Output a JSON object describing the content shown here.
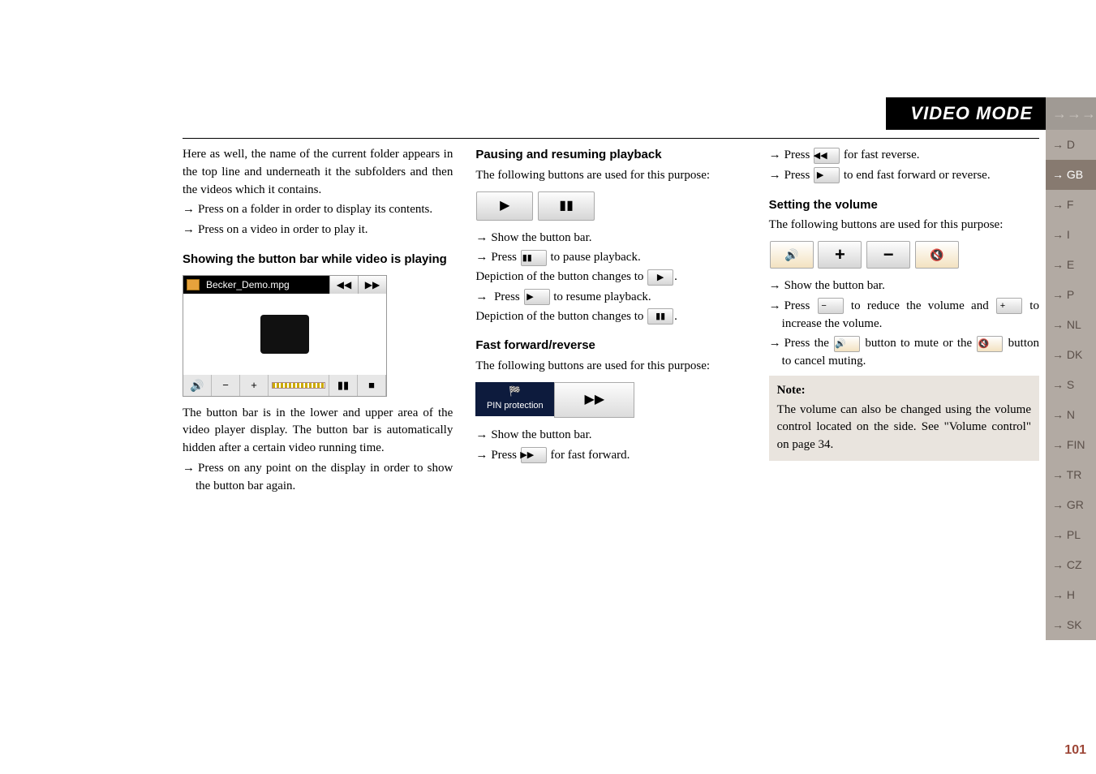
{
  "header": {
    "title": "VIDEO MODE",
    "arrows": "→→→"
  },
  "tabs": [
    {
      "label": "→ D",
      "active": false
    },
    {
      "label": "→ GB",
      "active": true
    },
    {
      "label": "→ F",
      "active": false
    },
    {
      "label": "→ I",
      "active": false
    },
    {
      "label": "→ E",
      "active": false
    },
    {
      "label": "→ P",
      "active": false
    },
    {
      "label": "→ NL",
      "active": false
    },
    {
      "label": "→ DK",
      "active": false
    },
    {
      "label": "→ S",
      "active": false
    },
    {
      "label": "→ N",
      "active": false
    },
    {
      "label": "→ FIN",
      "active": false
    },
    {
      "label": "→ TR",
      "active": false
    },
    {
      "label": "→ GR",
      "active": false
    },
    {
      "label": "→ PL",
      "active": false
    },
    {
      "label": "→ CZ",
      "active": false
    },
    {
      "label": "→ H",
      "active": false
    },
    {
      "label": "→ SK",
      "active": false
    }
  ],
  "col1": {
    "p1": "Here as well, the name of the current folder appears in the top line and underneath it the subfolders and then the videos which it contains.",
    "b1": "Press on a folder in order to display its contents.",
    "b2": "Press on a video in order to play it.",
    "h1": "Showing the button bar while video is playing",
    "player": {
      "title": "Becker_Demo.mpg",
      "rev": "◀◀",
      "fwd": "▶▶",
      "minus": "−",
      "plus": "+",
      "pause": "▮▮",
      "stop": "■"
    },
    "p2": "The button bar is in the lower and upper area of the video player display. The button bar is automatically hidden after a certain video running time.",
    "b3": "Press on any point on the display in order to show the button bar again."
  },
  "col2": {
    "h1": "Pausing and resuming playback",
    "p1": "The following buttons are used for this purpose:",
    "bigPlay": "▶",
    "bigPause": "▮▮",
    "b1": "Show the button bar.",
    "b2a": "Press ",
    "b2btn": "▮▮",
    "b2b": " to pause playback.",
    "p2a": "Depiction of the button changes to ",
    "p2btn": "▶",
    "p2b": ".",
    "b3a": " Press ",
    "b3btn": "▶",
    "b3b": " to resume playback.",
    "p3a": "Depiction of the button changes to ",
    "p3btn": "▮▮",
    "p3b": ".",
    "h2": "Fast forward/reverse",
    "p4": "The following buttons are used for this purpose:",
    "pin_label": "PIN protection",
    "pin_fwd": "▶▶",
    "b4": "Show the button bar.",
    "b5a": "Press ",
    "b5btn": "▶▶",
    "b5b": " for fast forward."
  },
  "col3": {
    "b1a": "Press ",
    "b1btn": "◀◀",
    "b1b": " for fast reverse.",
    "b2a": "Press ",
    "b2btn": "▶",
    "b2b": " to end fast forward or reverse.",
    "h1": "Setting the volume",
    "p1": "The following buttons are used for this purpose:",
    "volPlus": "+",
    "volMinus": "−",
    "b3": "Show the button bar.",
    "b4a": "Press ",
    "b4btnMinus": "−",
    "b4b": " to reduce the volume and ",
    "b4btnPlus": "+",
    "b4c": " to increase the volume.",
    "b5a": "Press the ",
    "b5b": " button to mute or the ",
    "b5c": " button to cancel muting.",
    "note_title": "Note:",
    "note_body": "The volume can also be changed using the volume control located on the side. See \"Volume control\" on page 34."
  },
  "page": "101"
}
